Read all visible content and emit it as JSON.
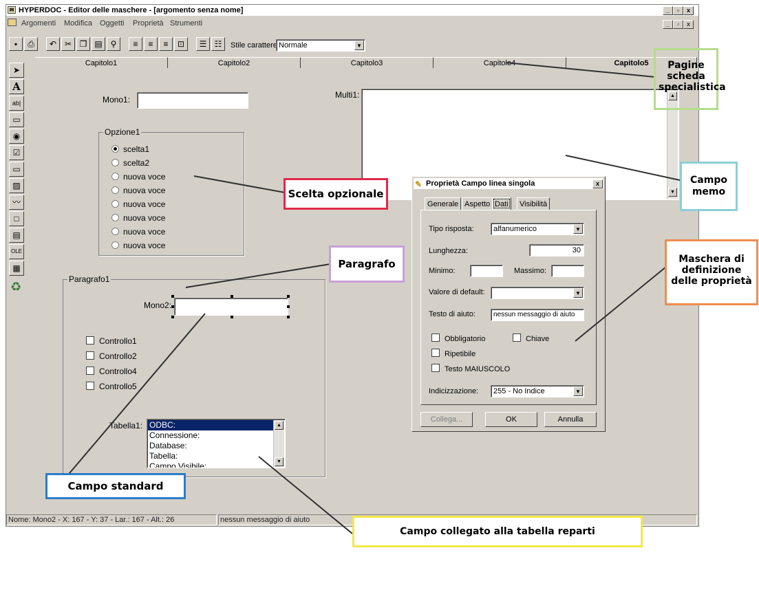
{
  "window": {
    "title": "HYPERDOC - Editor delle maschere - [argomento senza nome]",
    "controls": [
      "_",
      "б",
      "x"
    ]
  },
  "menu": [
    "Argomenti",
    "Modifica",
    "Oggetti",
    "Proprietà",
    "Strumenti"
  ],
  "toolbar": {
    "style_label": "Stile carattere:",
    "style_value": "Normale"
  },
  "tabs": [
    "Capitolo1",
    "Capitolo2",
    "Capitolo3",
    "Capitolo4",
    "Capitolo5"
  ],
  "form": {
    "mono1_label": "Mono1:",
    "multi1_label": "Multi1:",
    "opzione1": {
      "title": "Opzione1",
      "options": [
        "scelta1",
        "scelta2",
        "nuova voce",
        "nuova voce",
        "nuova voce",
        "nuova voce",
        "nuova voce",
        "nuova voce"
      ],
      "selected": 0
    },
    "paragrafo1": {
      "title": "Paragrafo1",
      "mono2_label": "Mono2:",
      "checks": [
        "Controllo1",
        "Controllo2",
        "Controllo4",
        "Controllo5"
      ],
      "tabella_label": "Tabella1:",
      "tabella_items": [
        "ODBC:",
        "Connessione:",
        "Database:",
        "Tabella:",
        "Campo Visibile:"
      ]
    }
  },
  "dialog": {
    "title": "Proprietà Campo linea singola",
    "tabs": [
      "Generale",
      "Aspetto",
      "Dati",
      "Visibilità"
    ],
    "active_tab": "Dati",
    "tipo_label": "Tipo risposta:",
    "tipo_value": "alfanumerico",
    "lunghezza_label": "Lunghezza:",
    "lunghezza_value": "30",
    "minimo_label": "Minimo:",
    "massimo_label": "Massimo:",
    "default_label": "Valore di default:",
    "aiuto_label": "Testo di aiuto:",
    "aiuto_value": "nessun messaggio di aiuto",
    "obbligatorio": "Obbligatorio",
    "chiave": "Chiave",
    "ripetibile": "Ripetibile",
    "maiuscolo": "Testo MAIUSCOLO",
    "indic_label": "Indicizzazione:",
    "indic_value": "255  - No Indice",
    "btn_collega": "Collega...",
    "btn_ok": "OK",
    "btn_annulla": "Annulla"
  },
  "status": {
    "left": "Nome: Mono2 - X: 167 - Y: 37 - Lar.: 167 - Alt.: 26",
    "right": "nessun messaggio di aiuto"
  },
  "annotations": {
    "pagine": "Pagine scheda specialistica",
    "memo": "Campo memo",
    "scelta": "Scelta opzionale",
    "paragrafo": "Paragrafo",
    "maschera": "Maschera di definizione delle proprietà",
    "standard": "Campo standard",
    "collegato": "Campo collegato alla tabella reparti"
  },
  "colors": {
    "green": "#b5dc8c",
    "teal": "#8ccfd6",
    "red": "#e0284a",
    "purple": "#c8a0d6",
    "orange": "#f08c50",
    "blue": "#2c7cc8",
    "yellow": "#f2e84c"
  }
}
